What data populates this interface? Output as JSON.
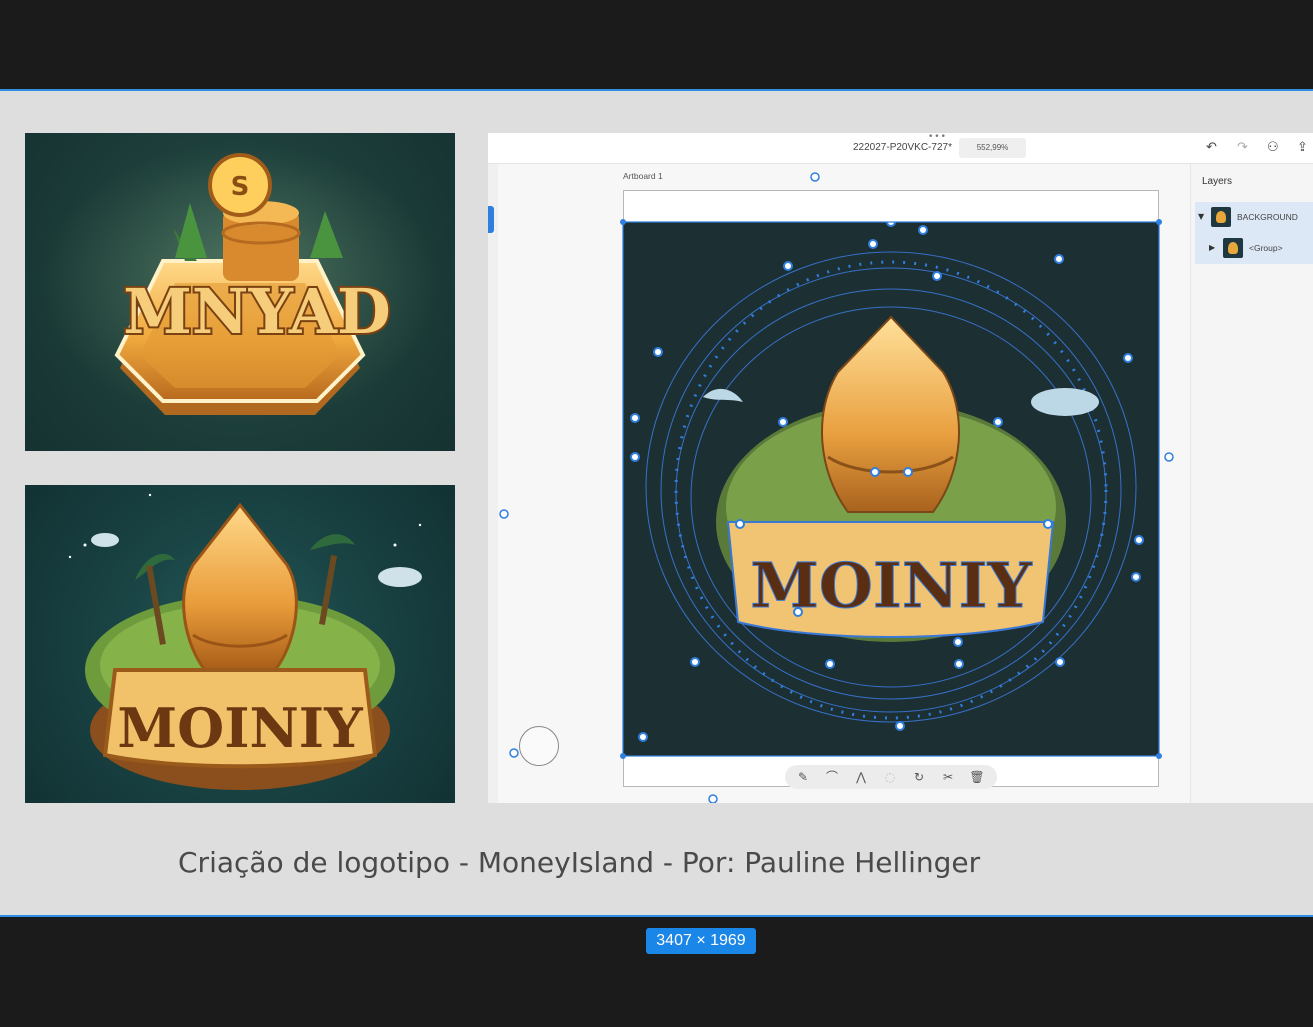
{
  "editor": {
    "document_title": "222027-P20VKC-727*",
    "zoom": "552,99%",
    "artboard_label": "Artboard 1",
    "icons": {
      "undo": "undo-icon",
      "redo": "redo-icon",
      "share": "share-user-icon",
      "export": "export-icon"
    }
  },
  "layers": {
    "title": "Layers",
    "items": [
      {
        "label": "BACKGROUND",
        "expanded": true
      },
      {
        "label": "<Group>",
        "expanded": false
      }
    ]
  },
  "path_toolbar": {
    "tools": [
      "pen-tool-icon",
      "add-anchor-icon",
      "convert-anchor-icon",
      "smooth-icon",
      "curvature-icon",
      "cut-path-icon",
      "delete-icon"
    ]
  },
  "artwork": {
    "logo1_text": "MNYAD",
    "logo1_coin_symbol": "S",
    "logo2_text": "MOINIY",
    "logo3_text": "MOINIY"
  },
  "caption": "Criação de logotipo -  MoneyIsland - Por: Pauline Hellinger",
  "dimensions_badge": "3407 × 1969",
  "colors": {
    "selection": "#2f7fe0",
    "badge": "#1a86e8",
    "gold": "#e8a73a"
  }
}
